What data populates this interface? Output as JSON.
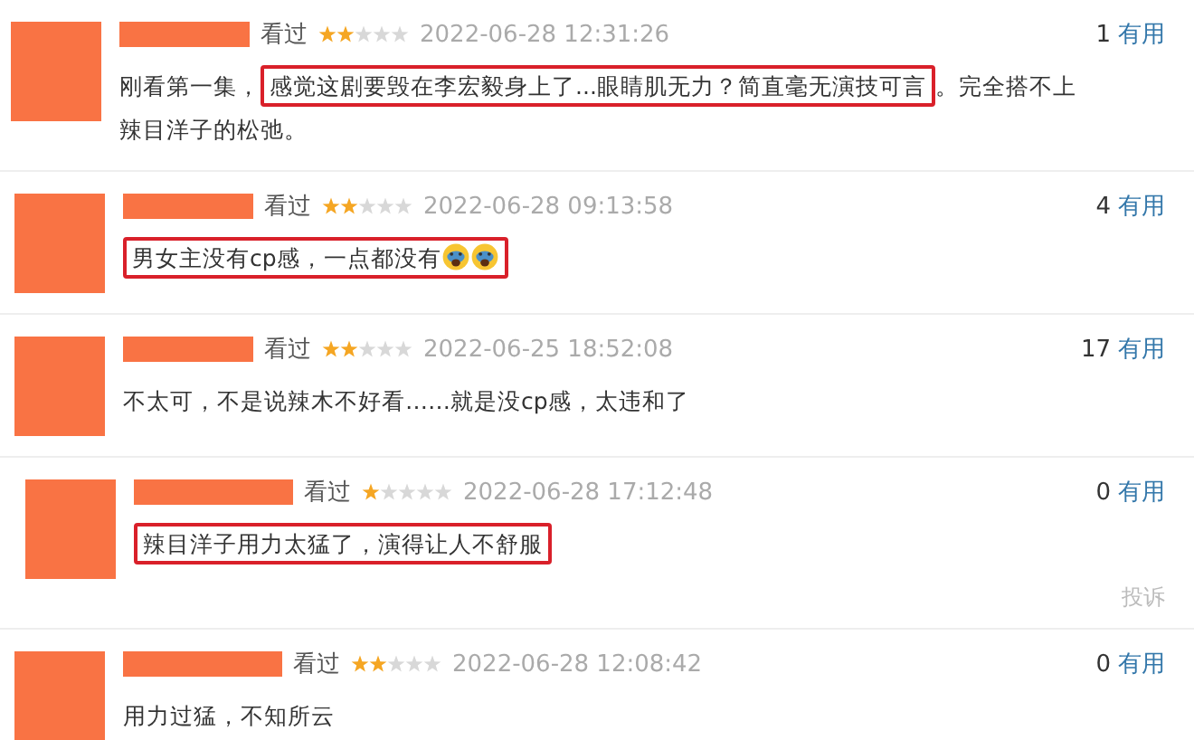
{
  "comments": [
    {
      "status": "看过",
      "stars": 2,
      "time": "2022-06-28 12:31:26",
      "votes": "1",
      "vote_label": "有用",
      "segments": [
        {
          "highlighted": false,
          "pieces": [
            {
              "kind": "text",
              "text": "刚看第一集，"
            }
          ]
        },
        {
          "highlighted": true,
          "pieces": [
            {
              "kind": "text",
              "text": "感觉这剧要毁在李宏毅身上了...眼睛肌无力？简直毫无演技可言"
            }
          ]
        },
        {
          "highlighted": false,
          "pieces": [
            {
              "kind": "text",
              "text": "。完全搭不上辣目洋子的松弛。"
            }
          ]
        }
      ]
    },
    {
      "status": "看过",
      "stars": 2,
      "time": "2022-06-28 09:13:58",
      "votes": "4",
      "vote_label": "有用",
      "segments": [
        {
          "highlighted": true,
          "pieces": [
            {
              "kind": "text",
              "text": "男女主没有cp感，一点都没有"
            },
            {
              "kind": "emoji"
            },
            {
              "kind": "emoji"
            }
          ]
        }
      ]
    },
    {
      "status": "看过",
      "stars": 2,
      "time": "2022-06-25 18:52:08",
      "votes": "17",
      "vote_label": "有用",
      "segments": [
        {
          "highlighted": false,
          "pieces": [
            {
              "kind": "text",
              "text": "不太可，不是说辣木不好看……就是没cp感，太违和了"
            }
          ]
        }
      ]
    },
    {
      "status": "看过",
      "stars": 1,
      "time": "2022-06-28 17:12:48",
      "votes": "0",
      "vote_label": "有用",
      "report": "投诉",
      "segments": [
        {
          "highlighted": true,
          "pieces": [
            {
              "kind": "text",
              "text": "辣目洋子用力太猛了，演得让人不舒服"
            }
          ]
        }
      ]
    },
    {
      "status": "看过",
      "stars": 2,
      "time": "2022-06-28 12:08:42",
      "votes": "0",
      "vote_label": "有用",
      "segments": [
        {
          "highlighted": false,
          "pieces": [
            {
              "kind": "text",
              "text": "用力过猛，不知所云"
            }
          ]
        }
      ]
    }
  ]
}
